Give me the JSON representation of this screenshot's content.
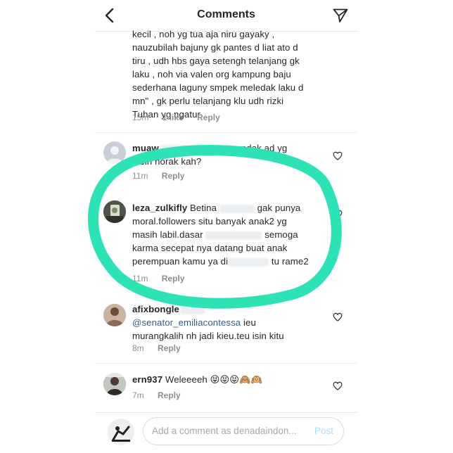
{
  "header": {
    "title": "Comments"
  },
  "comments": [
    {
      "lines": [
        "kecil , noh yg tua aja niru gayaky ,",
        "nauzubilah bajuny gk pantes d liat ato d",
        "tiru , udh hbs gaya setengh telanjang gk",
        "laku , noh via valen org kampung baju",
        "sederhana laguny smpek meledak laku d",
        "mn\" , gk perlu telanjang klu udh rizki",
        "Tuhan yg ngatur"
      ],
      "time": "15m",
      "likes": "1 like",
      "reply": "Reply"
    },
    {
      "username": "muaw",
      "line1_tail": "...ndak ad yg",
      "line2": "lebih norak kah?",
      "time": "11m",
      "reply": "Reply"
    },
    {
      "username": "leza_zulkifly",
      "l1a": "Betina",
      "l1b": "gak punya",
      "l2": "moral.followers situ banyak anak2 yg",
      "l3a": "masih labil.dasar",
      "l3b": "semoga",
      "l4": "karma secepat nya datang buat anak",
      "l5a": "perempuan kamu ya di",
      "l5b": "tu rame2",
      "time": "11m",
      "reply": "Reply"
    },
    {
      "username": "afixbongle",
      "mention": "@senator_emiliacontessa",
      "l1tail": "ieu",
      "l2": "murangkalih nh jadi kieu.teu isin kitu",
      "time": "8m",
      "reply": "Reply"
    },
    {
      "username": "ern937",
      "text": "Weleeeeh 😝😝😝🙈🙉",
      "time": "7m",
      "reply": "Reply"
    }
  ],
  "composer": {
    "placeholder": "Add a comment as denadaindon...",
    "post_label": "Post"
  },
  "colors": {
    "annotation_circle": "#2de3b6",
    "post_disabled": "#b3dbff",
    "muted": "#8e8e8e"
  }
}
